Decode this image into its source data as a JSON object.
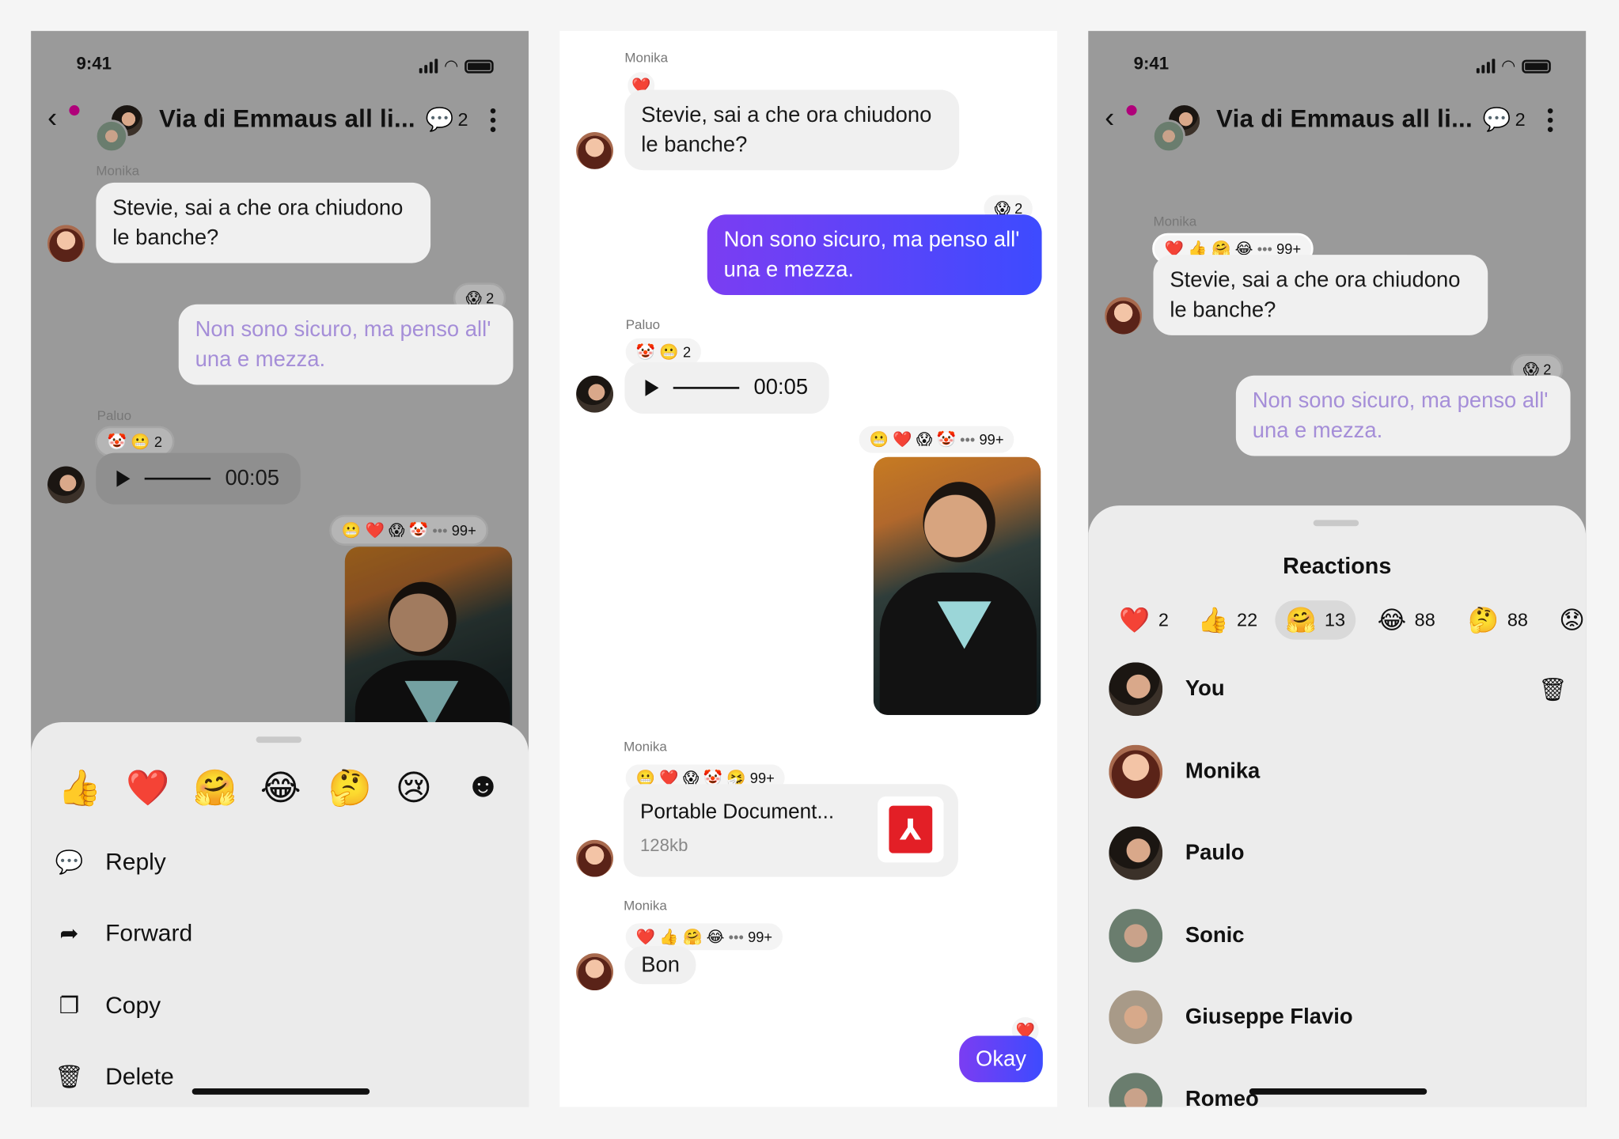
{
  "status": {
    "time": "9:41"
  },
  "header": {
    "title": "Via di Emmaus all li...",
    "thread_count": "2"
  },
  "messages": {
    "monika_name": "Monika",
    "paluo_name": "Paluo",
    "q1": "Stevie, sai a che ora chiudono le banche?",
    "a1": "Non sono sicuro, ma penso all' una e mezza.",
    "audio_time": "00:05",
    "file_name": "Portable Document...",
    "file_size": "128kb",
    "bon": "Bon",
    "okay": "Okay"
  },
  "reactions": {
    "scream_count": "2",
    "clown_grin_count": "2",
    "photo_count": "99+",
    "monika_count": "99+",
    "more": "•••"
  },
  "emoji_bar": [
    "👍",
    "❤️",
    "🤗",
    "😂",
    "🤔",
    "😢",
    "☻"
  ],
  "context_menu": [
    {
      "label": "Reply",
      "icon": "reply-icon"
    },
    {
      "label": "Forward",
      "icon": "forward-icon"
    },
    {
      "label": "Copy",
      "icon": "copy-icon"
    },
    {
      "label": "Delete",
      "icon": "delete-icon"
    }
  ],
  "reactions_sheet": {
    "title": "Reactions",
    "tabs": [
      {
        "emoji": "❤️",
        "count": "2"
      },
      {
        "emoji": "👍",
        "count": "22"
      },
      {
        "emoji": "🤗",
        "count": "13"
      },
      {
        "emoji": "😂",
        "count": "88"
      },
      {
        "emoji": "🤔",
        "count": "88"
      },
      {
        "emoji": "😟",
        "count": ""
      }
    ],
    "people": [
      "You",
      "Monika",
      "Paulo",
      "Sonic",
      "Giuseppe Flavio",
      "Romeo"
    ]
  },
  "colors": {
    "accent_start": "#7b3df2",
    "accent_end": "#3d4bff",
    "pdf_red": "#e31f26"
  }
}
